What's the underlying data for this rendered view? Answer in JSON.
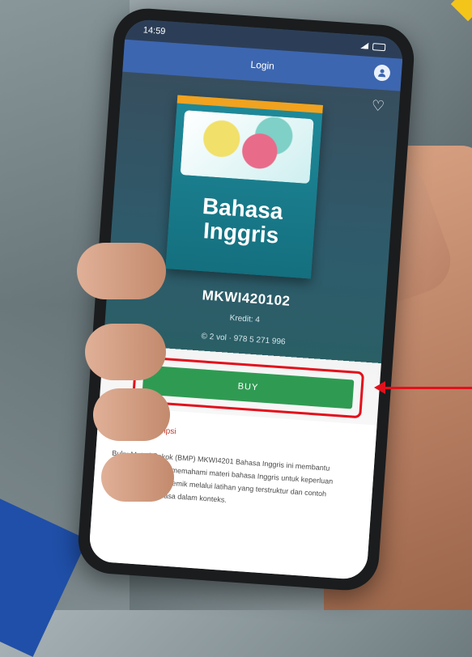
{
  "status_bar": {
    "time": "14:59"
  },
  "app_bar": {
    "title": "Login"
  },
  "book": {
    "cover_title_line1": "Bahasa",
    "cover_title_line2": "Inggris",
    "course_code": "MKWI420102",
    "course_meta": "Kredit: 4",
    "course_stats": "© 2 vol · 978 5 271 996"
  },
  "buy_button": {
    "label": "BUY"
  },
  "description": {
    "heading": "Deskripsi",
    "text": "Buku Materi Pokok (BMP) MKWI4201 Bahasa Inggris ini membantu mahasiswa dalam memahami materi bahasa Inggris untuk keperluan pembelajaran akademik melalui latihan yang terstruktur dan contoh penggunaan bahasa dalam konteks."
  },
  "colors": {
    "app_bar": "#3d66b0",
    "buy_button": "#2f9b52",
    "highlight": "#e3101b"
  }
}
